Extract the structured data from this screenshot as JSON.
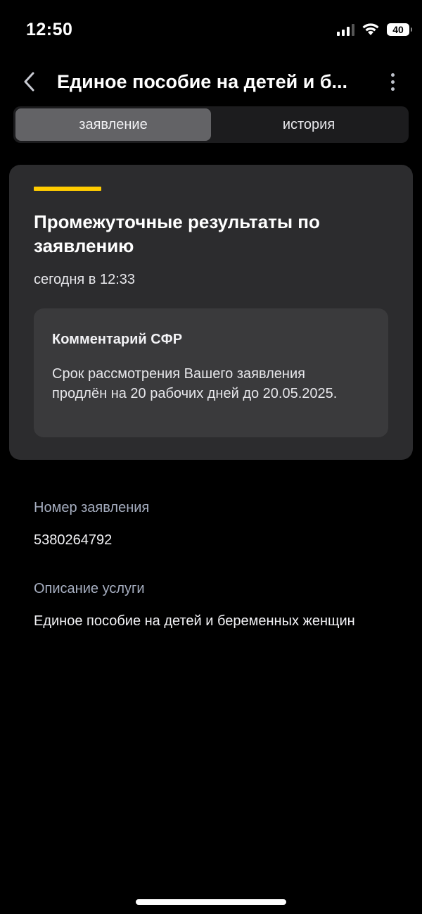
{
  "status_bar": {
    "time": "12:50",
    "battery_level": "40",
    "icons": [
      "signal-icon",
      "wifi-icon",
      "battery-icon"
    ]
  },
  "header": {
    "title": "Единое пособие на детей и б...",
    "back_icon": "chevron-left-icon",
    "more_icon": "more-vertical-icon"
  },
  "tabs": [
    {
      "label": "заявление",
      "active": true
    },
    {
      "label": "история",
      "active": false
    }
  ],
  "card": {
    "accent_color": "#ffcc00",
    "title": "Промежуточные результаты по заявлению",
    "time": "сегодня в 12:33",
    "comment": {
      "title": "Комментарий СФР",
      "text": "Срок рассмотрения Вашего заявления продлён на 20 рабочих дней до 20.05.2025."
    }
  },
  "details": {
    "number_label": "Номер заявления",
    "number_value": "5380264792",
    "service_label": "Описание услуги",
    "service_value": "Единое пособие на детей и беременных женщин"
  }
}
